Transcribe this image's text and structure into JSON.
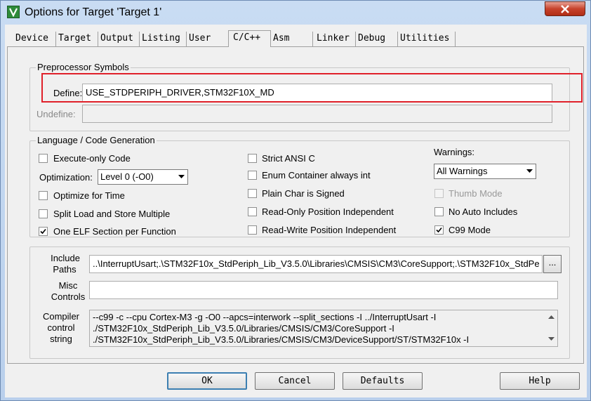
{
  "window": {
    "title": "Options for Target 'Target 1'"
  },
  "tabs": [
    {
      "label": "Device"
    },
    {
      "label": "Target"
    },
    {
      "label": "Output"
    },
    {
      "label": "Listing"
    },
    {
      "label": "User"
    },
    {
      "label": "C/C++"
    },
    {
      "label": "Asm"
    },
    {
      "label": "Linker"
    },
    {
      "label": "Debug"
    },
    {
      "label": "Utilities"
    }
  ],
  "active_tab": "C/C++",
  "preprocessor": {
    "group_title": "Preprocessor Symbols",
    "define_label": "Define:",
    "define_value": "USE_STDPERIPH_DRIVER,STM32F10X_MD",
    "undefine_label": "Undefine:",
    "undefine_value": ""
  },
  "language": {
    "group_title": "Language / Code Generation",
    "execute_only": {
      "label": "Execute-only Code",
      "checked": false
    },
    "optimization_label": "Optimization:",
    "optimization_value": "Level 0 (-O0)",
    "optimize_time": {
      "label": "Optimize for Time",
      "checked": false
    },
    "split_load": {
      "label": "Split Load and Store Multiple",
      "checked": false
    },
    "one_elf": {
      "label": "One ELF Section per Function",
      "checked": true
    },
    "strict_ansi": {
      "label": "Strict ANSI C",
      "checked": false
    },
    "enum_container": {
      "label": "Enum Container always int",
      "checked": false
    },
    "plain_char": {
      "label": "Plain Char is Signed",
      "checked": false
    },
    "ro_pi": {
      "label": "Read-Only Position Independent",
      "checked": false
    },
    "rw_pi": {
      "label": "Read-Write Position Independent",
      "checked": false
    },
    "warnings_label": "Warnings:",
    "warnings_value": "All Warnings",
    "thumb_mode": {
      "label": "Thumb Mode",
      "checked": false,
      "disabled": true
    },
    "no_auto_includes": {
      "label": "No Auto Includes",
      "checked": false
    },
    "c99_mode": {
      "label": "C99 Mode",
      "checked": true
    }
  },
  "paths": {
    "include_label_1": "Include",
    "include_label_2": "Paths",
    "include_value": "..\\InterruptUsart;.\\STM32F10x_StdPeriph_Lib_V3.5.0\\Libraries\\CMSIS\\CM3\\CoreSupport;.\\STM32F10x_StdPe",
    "browse_label": "...",
    "misc_label_1": "Misc",
    "misc_label_2": "Controls",
    "misc_value": "",
    "compiler_label_1": "Compiler",
    "compiler_label_2": "control",
    "compiler_label_3": "string",
    "compiler_lines": [
      "--c99 -c --cpu Cortex-M3 -g -O0 --apcs=interwork --split_sections -I ../InterruptUsart -I",
      "./STM32F10x_StdPeriph_Lib_V3.5.0/Libraries/CMSIS/CM3/CoreSupport -I",
      "./STM32F10x_StdPeriph_Lib_V3.5.0/Libraries/CMSIS/CM3/DeviceSupport/ST/STM32F10x -I"
    ]
  },
  "buttons": {
    "ok": "OK",
    "cancel": "Cancel",
    "defaults": "Defaults",
    "help": "Help"
  },
  "colors": {
    "highlight": "#e0202a",
    "titlebar": "#c9dcf3",
    "close": "#c7432c"
  }
}
